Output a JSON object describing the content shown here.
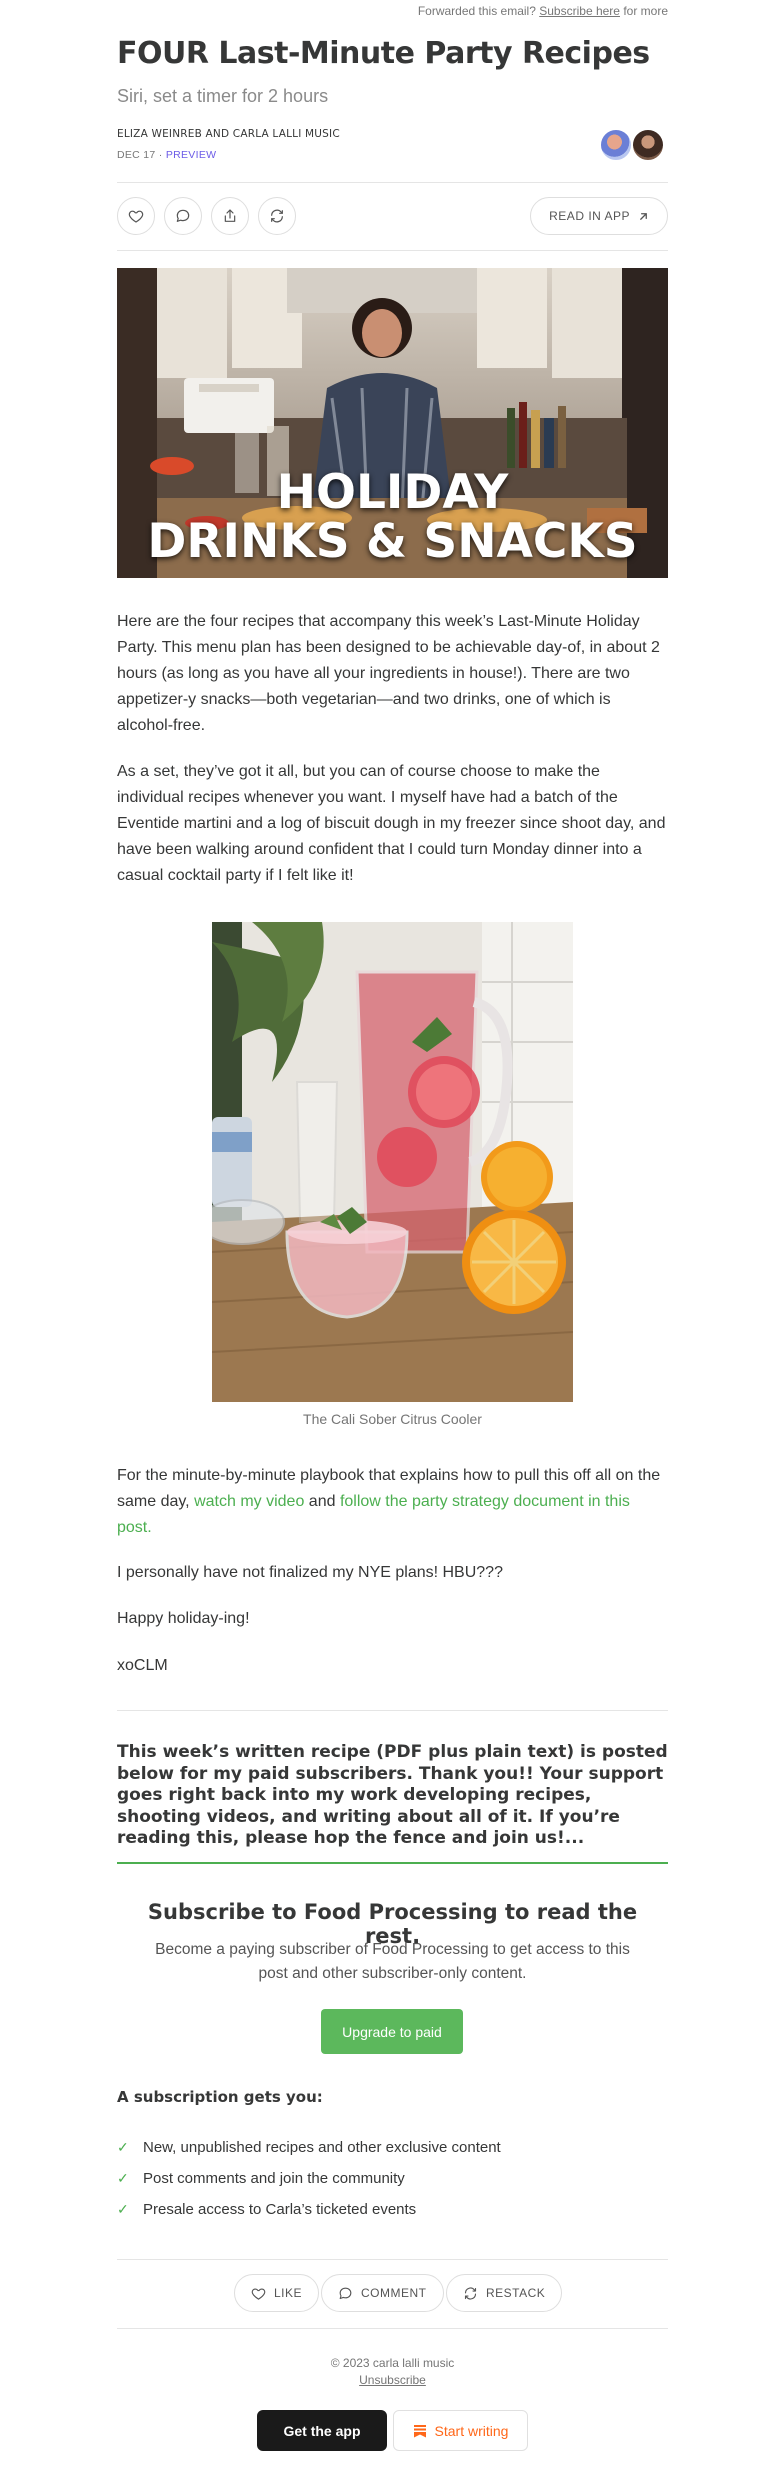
{
  "header": {
    "forward_prefix": "Forwarded this email?",
    "forward_link": "Subscribe here",
    "forward_suffix": "for more"
  },
  "post": {
    "title": "FOUR Last-Minute Party Recipes",
    "subtitle": "Siri, set a timer for 2 hours",
    "authors": "ELIZA WEINREB AND CARLA LALLI MUSIC",
    "date": "DEC 17",
    "separator": "·",
    "preview_label": "PREVIEW"
  },
  "actions": {
    "like_icon": "heart-icon",
    "comment_icon": "comment-icon",
    "share_icon": "share-icon",
    "restack_icon": "restack-icon",
    "read_in_app": "READ IN APP"
  },
  "hero": {
    "line1": "HOLIDAY",
    "line2": "DRINKS & SNACKS"
  },
  "body": {
    "p1": "Here are the four recipes that accompany this week’s Last-Minute Holiday Party. This menu plan has been designed to be achievable day-of, in about 2 hours (as long as you have all your ingredients in house!). There are two appetizer-y snacks—both vegetarian—and two drinks, one of which is alcohol-free.",
    "p2": "As a set, they’ve got it all, but you can of course choose to make the individual recipes whenever you want. I myself have had a batch of the Eventide martini and a log of biscuit dough in my freezer since shoot day, and have been walking around confident that I could turn Monday dinner into a casual cocktail party if I felt like it!",
    "caption": "The Cali Sober Citrus Cooler",
    "p3_before": "For the minute-by-minute playbook that explains how to pull this off all on the same day,",
    "p3_link1": "watch my video",
    "p3_middle": "and",
    "p3_link2": "follow the party strategy document in this post.",
    "p4": "I personally have not finalized my NYE plans! HBU???",
    "p5": "Happy holiday-ing!",
    "p6": "xoCLM"
  },
  "paywall": {
    "text": "This week’s written recipe (PDF plus plain text) is posted below for my paid subscribers. Thank you!! Your support goes right back into my work developing recipes, shooting videos, and writing about all of it. If you’re reading this, please hop the fence and join us!...",
    "heading": "Subscribe to Food Processing to read the rest.",
    "description": "Become a paying subscriber of Food Processing to get access to this post and other subscriber-only content.",
    "upgrade_label": "Upgrade to paid",
    "gets_label": "A subscription gets you:",
    "benefits": [
      "New, unpublished recipes and other exclusive content",
      "Post comments and join the community",
      "Presale access to Carla’s ticketed events"
    ]
  },
  "footer_actions": {
    "like": "LIKE",
    "comment": "COMMENT",
    "restack": "RESTACK"
  },
  "footer": {
    "copyright": "© 2023 carla lalli music",
    "unsubscribe": "Unsubscribe",
    "get_app": "Get the app",
    "start_writing": "Start writing"
  },
  "colors": {
    "accent_green": "#4caf50",
    "upgrade_button": "#5cb85c",
    "preview_purple": "#6c5ce7",
    "substack_orange": "#ff6719"
  }
}
